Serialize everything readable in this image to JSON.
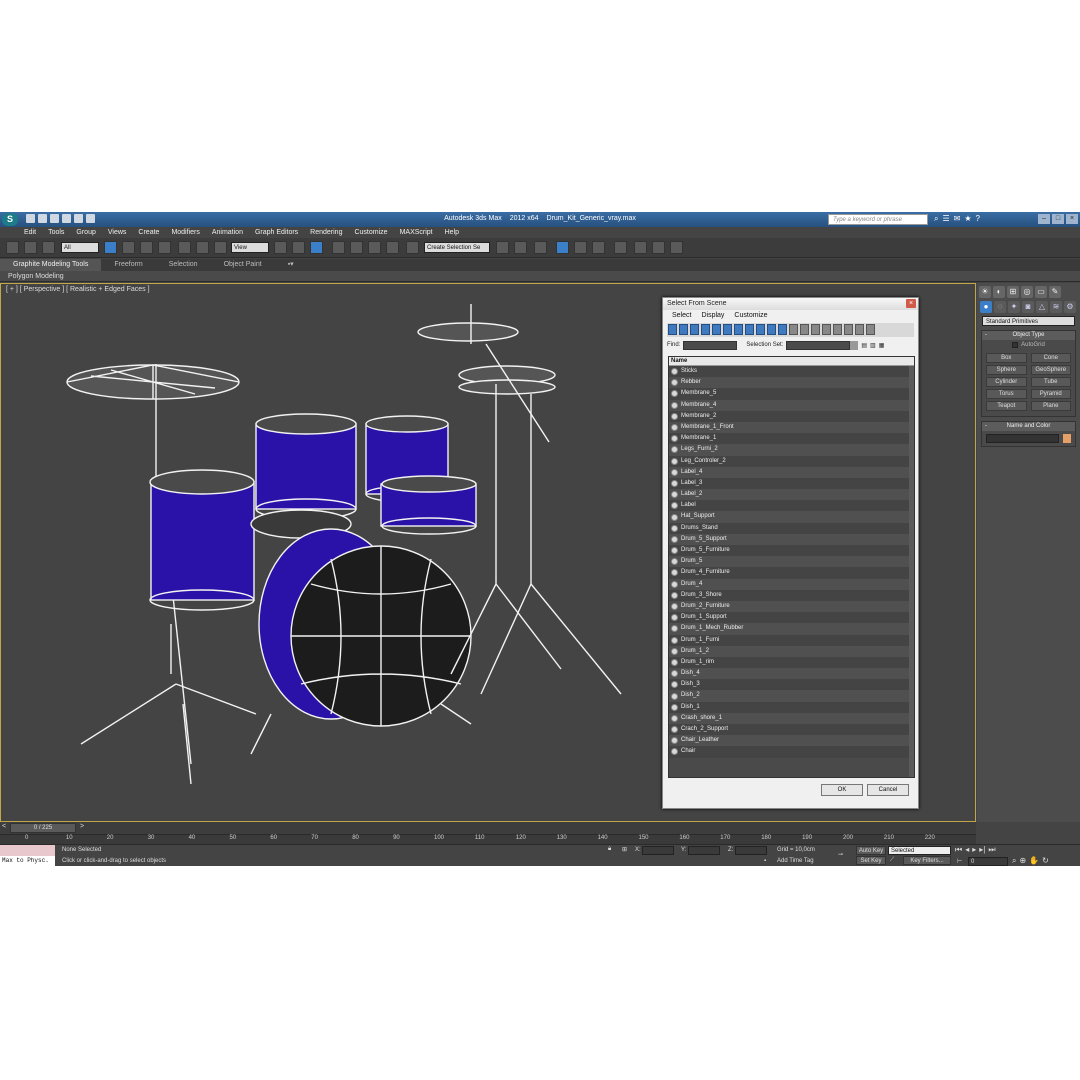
{
  "window": {
    "app_name": "Autodesk 3ds Max",
    "version": "2012 x64",
    "file_name": "Drum_Kit_Generic_vray.max",
    "search_placeholder": "Type a keyword or phrase"
  },
  "menu": [
    "Edit",
    "Tools",
    "Group",
    "Views",
    "Create",
    "Modifiers",
    "Animation",
    "Graph Editors",
    "Rendering",
    "Customize",
    "MAXScript",
    "Help"
  ],
  "toolbar": {
    "filter_value": "All",
    "ref_coord_value": "View",
    "selection_set_placeholder": "Create Selection Se"
  },
  "ribbon": {
    "tabs": [
      "Graphite Modeling Tools",
      "Freeform",
      "Selection",
      "Object Paint"
    ],
    "sub_label": "Polygon Modeling"
  },
  "viewport": {
    "label": "[ + ] [ Perspective ] [ Realistic + Edged Faces ]"
  },
  "command_panel": {
    "category_value": "Standard Primitives",
    "object_type_title": "Object Type",
    "autogrid_label": "AutoGrid",
    "object_buttons": [
      "Box",
      "Cone",
      "Sphere",
      "GeoSphere",
      "Cylinder",
      "Tube",
      "Torus",
      "Pyramid",
      "Teapot",
      "Plane"
    ],
    "name_color_title": "Name and Color",
    "object_color": "#e4a067"
  },
  "dialog": {
    "title": "Select From Scene",
    "menu": [
      "Select",
      "Display",
      "Customize"
    ],
    "find_label": "Find:",
    "selection_set_label": "Selection Set:",
    "column_header": "Name",
    "items": [
      "Sticks",
      "Rebber",
      "Membrane_5",
      "Membrane_4",
      "Membrane_2",
      "Membrane_1_Front",
      "Membrane_1",
      "Legs_Furni_2",
      "Leg_Controler_2",
      "Label_4",
      "Label_3",
      "Label_2",
      "Label",
      "Hat_Support",
      "Drums_Stand",
      "Drum_5_Support",
      "Drum_5_Furniture",
      "Drum_5",
      "Drum_4_Furniture",
      "Drum_4",
      "Drum_3_Shore",
      "Drum_2_Furniture",
      "Drum_1_Support",
      "Drum_1_Mech_Rubber",
      "Drum_1_Furni",
      "Drum_1_2",
      "Drum_1_rim",
      "Dish_4",
      "Dish_3",
      "Dish_2",
      "Dish_1",
      "Crash_shore_1",
      "Crach_2_Support",
      "Chair_Leather",
      "Chair"
    ],
    "ok_label": "OK",
    "cancel_label": "Cancel"
  },
  "timeline": {
    "frame_display": "0 / 225",
    "ticks": [
      "0",
      "10",
      "20",
      "30",
      "40",
      "50",
      "60",
      "70",
      "80",
      "90",
      "100",
      "110",
      "120",
      "130",
      "140",
      "150",
      "160",
      "170",
      "180",
      "190",
      "200",
      "210",
      "220"
    ]
  },
  "status": {
    "script_text": "Max to Physc.",
    "selection_text": "None Selected",
    "prompt_text": "Click or click-and-drag to select objects",
    "x_label": "X:",
    "y_label": "Y:",
    "z_label": "Z:",
    "grid_text": "Grid = 10,0cm",
    "add_time_tag": "Add Time Tag",
    "auto_key": "Auto Key",
    "auto_key_value": "Selected",
    "set_key": "Set Key",
    "key_filters": "Key Filters...",
    "frame_value": "0"
  }
}
